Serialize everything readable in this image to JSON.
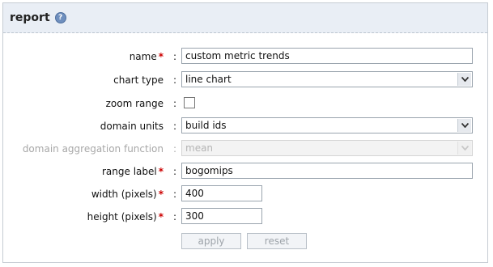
{
  "panel": {
    "title": "report",
    "help_icon": "help-circle-icon"
  },
  "form": {
    "name": {
      "label": "name",
      "required": "*",
      "colon": ":",
      "value": "custom metric trends"
    },
    "chart_type": {
      "label": "chart type",
      "colon": ":",
      "value": "line chart"
    },
    "zoom_range": {
      "label": "zoom range",
      "colon": ":",
      "checked": false
    },
    "domain_units": {
      "label": "domain units",
      "colon": ":",
      "value": "build ids"
    },
    "domain_aggregation": {
      "label": "domain aggregation function",
      "colon": ":",
      "value": "mean",
      "disabled": true
    },
    "range_label": {
      "label": "range label",
      "required": "*",
      "colon": ":",
      "value": "bogomips"
    },
    "width": {
      "label": "width (pixels)",
      "required": "*",
      "colon": ":",
      "value": "400"
    },
    "height": {
      "label": "height (pixels)",
      "required": "*",
      "colon": ":",
      "value": "300"
    }
  },
  "buttons": {
    "apply": "apply",
    "reset": "reset"
  },
  "colors": {
    "header_bg": "#e9eef5",
    "required": "#cc0000",
    "disabled_text": "#a8a8a8"
  }
}
